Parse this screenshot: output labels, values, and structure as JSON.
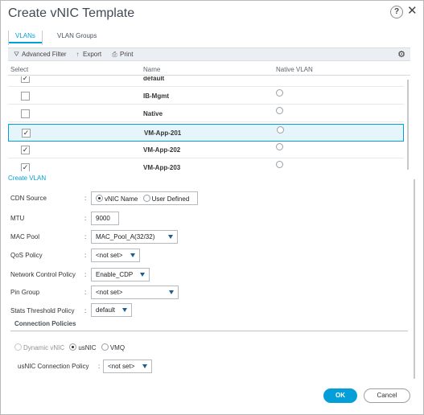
{
  "dialog": {
    "title": "Create vNIC Template",
    "help_label": "?",
    "close_label": "✕"
  },
  "tabs": [
    {
      "label": "VLANs",
      "active": true
    },
    {
      "label": "VLAN Groups",
      "active": false
    }
  ],
  "toolbar": {
    "filter_label": "Advanced Filter",
    "export_label": "Export",
    "print_label": "Print",
    "filter_icon": "filter-icon",
    "export_icon": "export-icon",
    "print_icon": "print-icon",
    "settings_icon": "gear-icon"
  },
  "grid": {
    "columns": [
      "Select",
      "Name",
      "Native VLAN"
    ],
    "rows": [
      {
        "name": "default",
        "checked": true,
        "native": true,
        "selected": false
      },
      {
        "name": "IB-Mgmt",
        "checked": false,
        "native": false,
        "selected": false
      },
      {
        "name": "Native",
        "checked": false,
        "native": false,
        "selected": false
      },
      {
        "name": "VM-App-201",
        "checked": true,
        "native": false,
        "selected": true
      },
      {
        "name": "VM-App-202",
        "checked": true,
        "native": false,
        "selected": false
      },
      {
        "name": "VM-App-203",
        "checked": true,
        "native": false,
        "selected": false
      }
    ]
  },
  "create_vlan_label": "Create VLAN",
  "form": {
    "cdn_source": {
      "label": "CDN Source",
      "options": [
        "vNIC Name",
        "User Defined"
      ],
      "selected": "vNIC Name"
    },
    "mtu": {
      "label": "MTU",
      "value": "9000"
    },
    "mac_pool": {
      "label": "MAC Pool",
      "value": "MAC_Pool_A(32/32)"
    },
    "qos_policy": {
      "label": "QoS Policy",
      "value": "<not set>"
    },
    "network_control_policy": {
      "label": "Network Control Policy",
      "value": "Enable_CDP"
    },
    "pin_group": {
      "label": "Pin Group",
      "value": "<not set>"
    },
    "stats_threshold_policy": {
      "label": "Stats Threshold Policy",
      "value": "default"
    }
  },
  "connection_policies": {
    "title": "Connection Policies",
    "options": [
      "Dynamic vNIC",
      "usNIC",
      "VMQ"
    ],
    "selected": "usNIC",
    "usnic_policy": {
      "label": "usNIC Connection Policy",
      "value": "<not set>"
    }
  },
  "buttons": {
    "ok": "OK",
    "cancel": "Cancel"
  },
  "colors": {
    "accent": "#049fd9",
    "selected_row": "#e6f4fb"
  }
}
